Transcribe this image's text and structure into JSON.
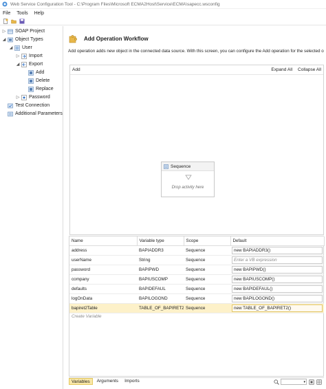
{
  "window": {
    "title": "Web Service Configuration Tool - C:\\Program Files\\Microsoft ECMA2Host\\Service\\ECMA\\sapecc.wsconfig"
  },
  "menu": [
    "File",
    "Tools",
    "Help"
  ],
  "tree": {
    "soap_project": "SOAP Project",
    "object_types": "Object Types",
    "user": "User",
    "import": "Import",
    "export": "Export",
    "add": "Add",
    "delete": "Delete",
    "replace": "Replace",
    "password": "Password",
    "test_connection": "Test Connection",
    "additional_parameters": "Additional Parameters"
  },
  "page": {
    "title": "Add Operation Workflow",
    "description": "Add operation adds new object in the connected data source. With this screen, you can configure the Add operation for the selected o"
  },
  "designer": {
    "breadcrumb": "Add",
    "expand_all": "Expand All",
    "collapse_all": "Collapse All",
    "sequence_title": "Sequence",
    "drop_hint": "Drop activity here"
  },
  "variables": {
    "columns": [
      "Name",
      "Variable type",
      "Scope",
      "Default"
    ],
    "rows": [
      {
        "name": "address",
        "type": "BAPIADDR3",
        "scope": "Sequence",
        "default": "new BAPIADDR3()",
        "placeholder": false,
        "selected": false
      },
      {
        "name": "userName",
        "type": "String",
        "scope": "Sequence",
        "default": "Enter a VB expression",
        "placeholder": true,
        "selected": false
      },
      {
        "name": "password",
        "type": "BAPIPWD",
        "scope": "Sequence",
        "default": "new BAPIPWD()",
        "placeholder": false,
        "selected": false
      },
      {
        "name": "company",
        "type": "BAPIUSCOMP",
        "scope": "Sequence",
        "default": "new BAPIUSCOMP()",
        "placeholder": false,
        "selected": false
      },
      {
        "name": "defaults",
        "type": "BAPIDEFAUL",
        "scope": "Sequence",
        "default": "new BAPIDEFAUL()",
        "placeholder": false,
        "selected": false
      },
      {
        "name": "logOnData",
        "type": "BAPILOGOND",
        "scope": "Sequence",
        "default": "new BAPILOGOND()",
        "placeholder": false,
        "selected": false
      },
      {
        "name": "bapiret2Table",
        "type": "TABLE_OF_BAPIRET2",
        "scope": "Sequence",
        "default": "new TABLE_OF_BAPIRET2()",
        "placeholder": false,
        "selected": true
      }
    ],
    "create_hint": "Create Variable"
  },
  "bottom_tabs": [
    "Variables",
    "Arguments",
    "Imports"
  ],
  "colors": {
    "selection": "#fdf1c9",
    "active_tab": "#f9e7a8",
    "folder": "#e8b84a",
    "accent": "#2e6fc4"
  }
}
